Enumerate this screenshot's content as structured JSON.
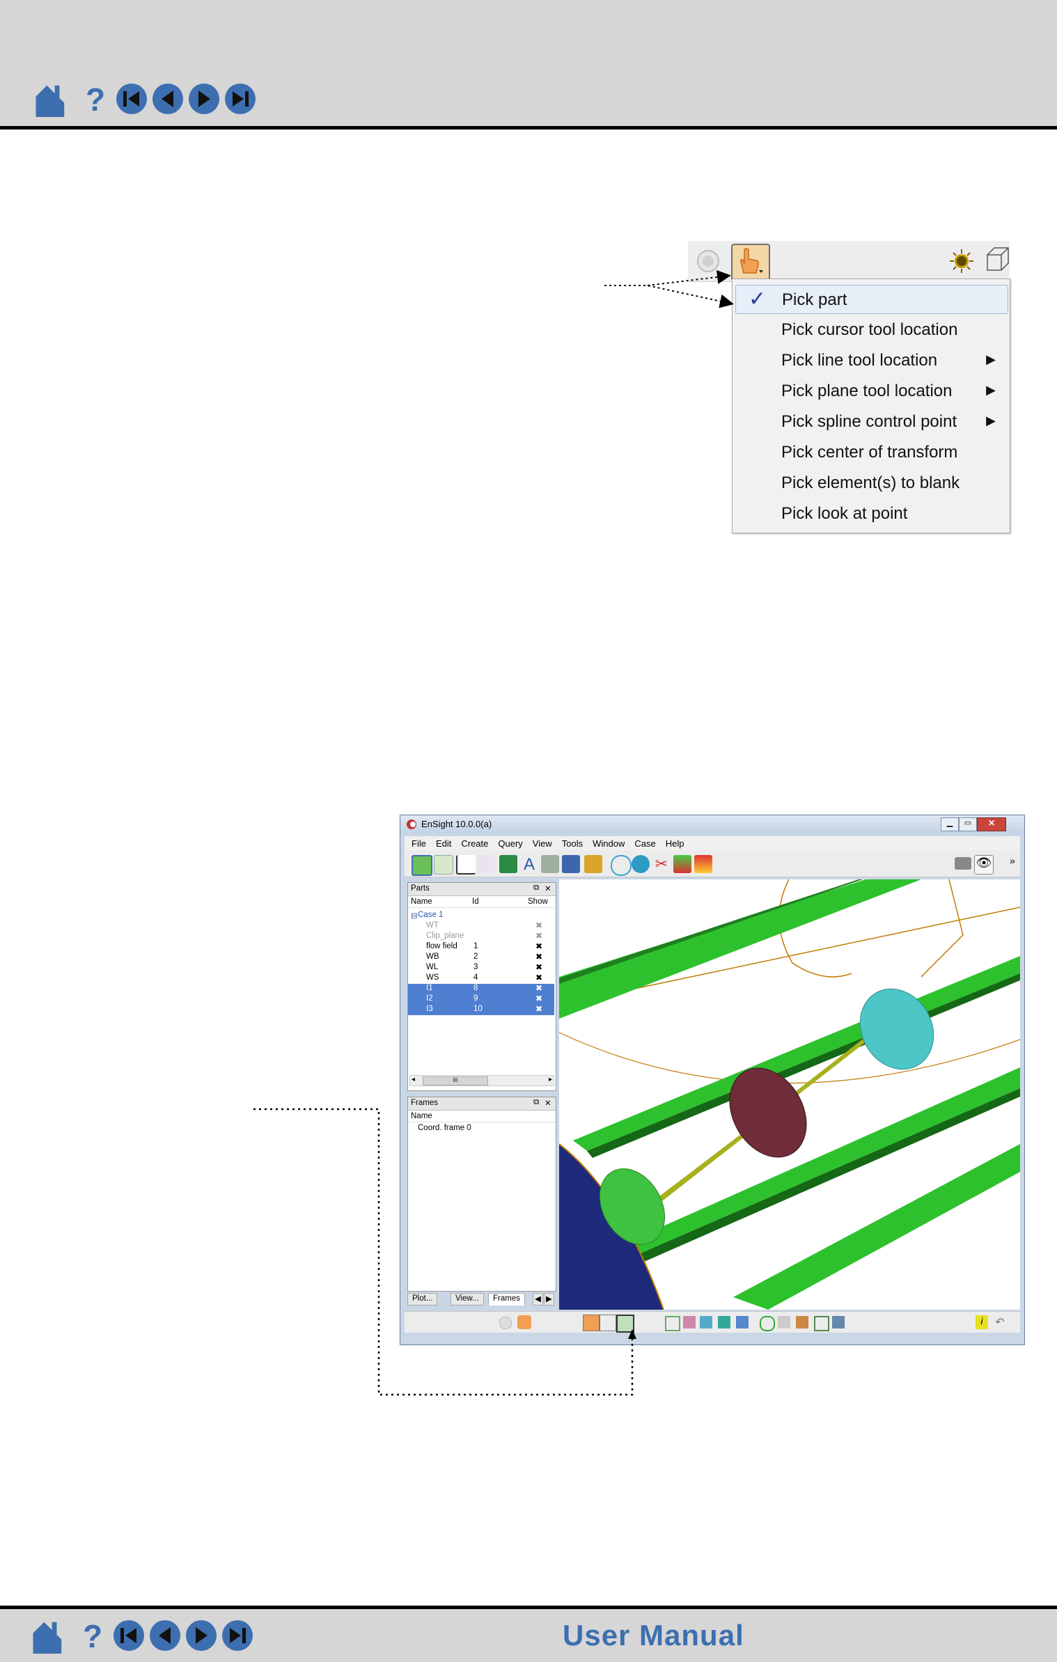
{
  "pick_menu": {
    "items": [
      {
        "label": "Pick part",
        "checked": true,
        "submenu": false
      },
      {
        "label": "Pick cursor tool location",
        "checked": false,
        "submenu": false
      },
      {
        "label": "Pick line tool location",
        "checked": false,
        "submenu": true
      },
      {
        "label": "Pick plane tool location",
        "checked": false,
        "submenu": true
      },
      {
        "label": "Pick spline control point",
        "checked": false,
        "submenu": true
      },
      {
        "label": "Pick center of transform",
        "checked": false,
        "submenu": false
      },
      {
        "label": "Pick element(s) to blank",
        "checked": false,
        "submenu": false
      },
      {
        "label": "Pick look at point",
        "checked": false,
        "submenu": false
      }
    ]
  },
  "ensight": {
    "title": "EnSight 10.0.0(a)",
    "menu": [
      "File",
      "Edit",
      "Create",
      "Query",
      "View",
      "Tools",
      "Window",
      "Case",
      "Help"
    ],
    "parts_panel": {
      "title": "Parts",
      "columns": [
        "Name",
        "Id",
        "Show"
      ],
      "group": "Case 1",
      "rows": [
        {
          "name": "WT",
          "id": "",
          "state": "dim"
        },
        {
          "name": "Clip_plane",
          "id": "",
          "state": "dim"
        },
        {
          "name": "flow field",
          "id": "1",
          "state": "normal"
        },
        {
          "name": "WB",
          "id": "2",
          "state": "normal"
        },
        {
          "name": "WL",
          "id": "3",
          "state": "normal"
        },
        {
          "name": "WS",
          "id": "4",
          "state": "normal"
        },
        {
          "name": "I1",
          "id": "8",
          "state": "selected"
        },
        {
          "name": "I2",
          "id": "9",
          "state": "selected"
        },
        {
          "name": "I3",
          "id": "10",
          "state": "selected"
        }
      ],
      "scroll_label": "III"
    },
    "frames_panel": {
      "title": "Frames",
      "column": "Name",
      "item": "Coord. frame 0"
    },
    "tabs": [
      "Plot...",
      "View...",
      "Frames"
    ]
  },
  "footer": {
    "title": "User Manual"
  },
  "colors": {
    "bar": "#d6d6d6",
    "brand_blue": "#3d6fb0",
    "selection": "#4f7fd0",
    "part_green": "#2ec12e"
  }
}
